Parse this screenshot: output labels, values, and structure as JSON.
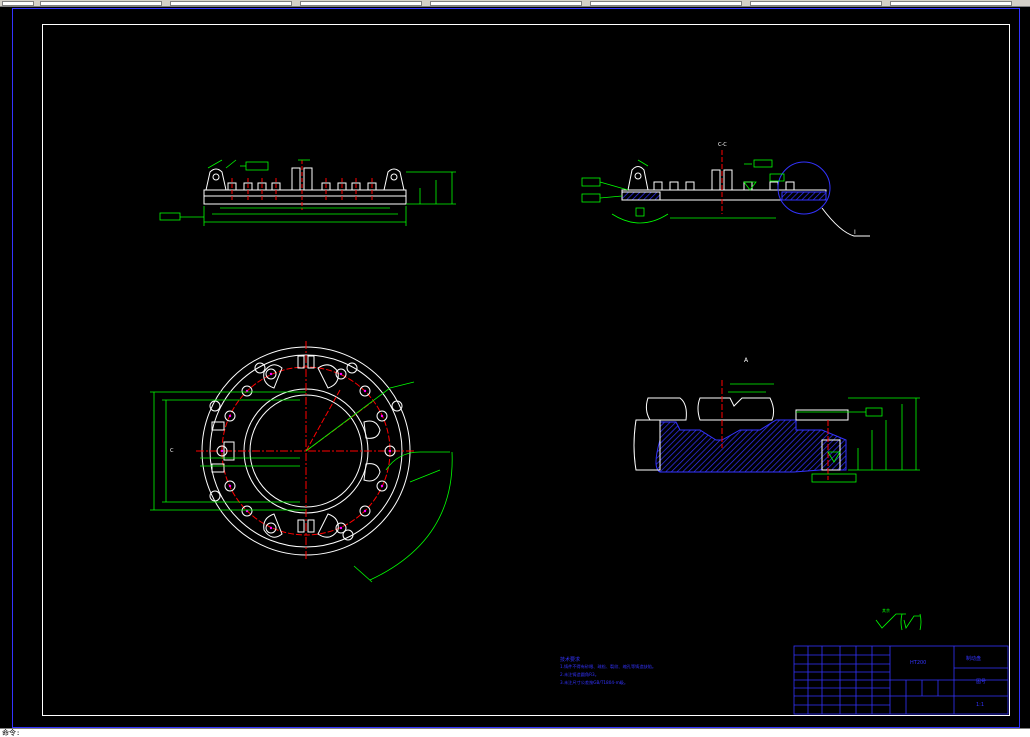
{
  "colors": {
    "background": "#000000",
    "outline": "#ffffff",
    "dimension": "#00ff00",
    "centerline": "#ff0000",
    "hatch": "#3333ff",
    "titleblock": "#3333ff",
    "magenta": "#ff00ff",
    "frame": "#3333ff"
  },
  "command_line": {
    "prompt": "命令: "
  },
  "views": {
    "section_a_label": "A",
    "section_c_label": "C",
    "view_label_cc": "C-C",
    "detail_label": "I"
  },
  "technical_requirements": {
    "title": "技术要求",
    "lines": [
      "1.铸件不得有砂眼、疏松、裂纹、缩孔等铸造缺陷。",
      "2.未注铸造圆角R3。",
      "3.未注尺寸公差按GB/T1804-m级。"
    ]
  },
  "title_block": {
    "part_name": "制动盘",
    "material": "HT200",
    "drawing_no": "图号",
    "scale": "1:1"
  },
  "roughness_note": "其余"
}
